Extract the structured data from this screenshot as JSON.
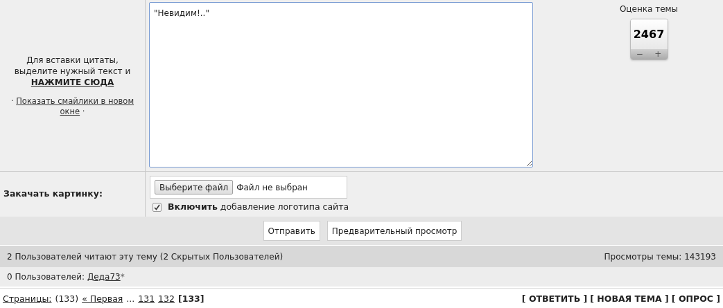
{
  "quote_hint": {
    "text": "Для вставки цитаты, выделите нужный текст и",
    "link": "НАЖМИТЕ СЮДА"
  },
  "smilies": {
    "bullet_before": "·",
    "link": "Показать смайлики в новом окне",
    "bullet_after": "·"
  },
  "message": {
    "value": "\"Невидим!..\""
  },
  "rating": {
    "title": "Оценка темы",
    "value": "2467",
    "minus": "−",
    "plus": "+"
  },
  "upload": {
    "label": "Закачать картинку:",
    "choose_button": "Выберите файл",
    "file_status": "Файл не выбран",
    "logo_checkbox": {
      "checked": true,
      "bold": "Включить",
      "text": "добавление логотипа сайта"
    }
  },
  "buttons": [
    "Отправить",
    "Предварительный просмотр"
  ],
  "readers": {
    "text": "2 Пользователей читают эту тему (2 Скрытых Пользователей)",
    "views": "Просмотры темы: 143193"
  },
  "users": {
    "prefix": "0 Пользователей:",
    "name": "Деда73",
    "suffix": "*"
  },
  "pagination": {
    "label": "Страницы:",
    "count": "(133)",
    "first": "« Первая",
    "ellipsis": "...",
    "pages": [
      {
        "label": "131",
        "selected": false
      },
      {
        "label": "132",
        "selected": false
      },
      {
        "label": "[133]",
        "selected": true
      }
    ]
  },
  "actions": [
    "[ ОТВЕТИТЬ ]",
    "[ НОВАЯ ТЕМА ]",
    "[ ОПРОС ]"
  ]
}
